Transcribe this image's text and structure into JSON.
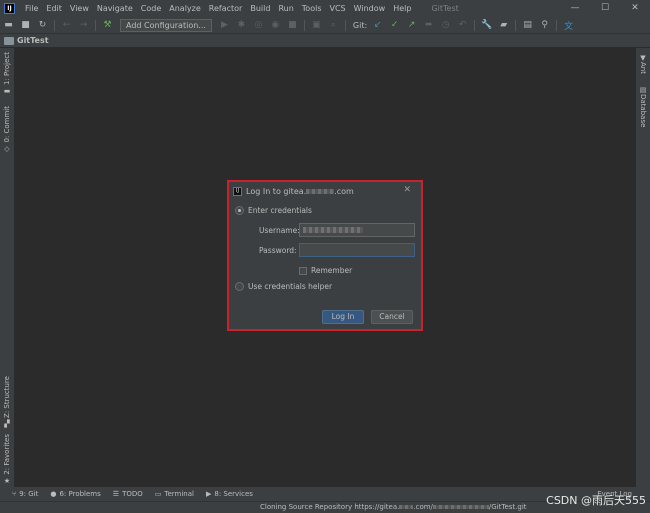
{
  "window": {
    "title": "GitTest",
    "menu": [
      "File",
      "Edit",
      "View",
      "Navigate",
      "Code",
      "Analyze",
      "Refactor",
      "Build",
      "Run",
      "Tools",
      "VCS",
      "Window",
      "Help"
    ],
    "controls": {
      "minimize": "—",
      "maximize": "☐",
      "close": "✕"
    }
  },
  "toolbar": {
    "config_label": "Add Configuration...",
    "git_label": "Git:"
  },
  "navbar": {
    "project": "GitTest"
  },
  "left_tabs": {
    "project": "1: Project",
    "commit": "0: Commit",
    "structure": "Z: Structure",
    "favorites": "2: Favorites"
  },
  "right_tabs": {
    "ant": "Ant",
    "database": "Database"
  },
  "bottom_tabs": {
    "git": "9: Git",
    "problems": "6: Problems",
    "todo": "TODO",
    "terminal": "Terminal",
    "services": "8: Services",
    "event_log": "Event Log"
  },
  "status": {
    "text_prefix": "Cloning Source Repository https://gitea.",
    "text_mid": ".com/",
    "text_suffix": "/GitTest.git"
  },
  "watermark": "CSDN @雨后天555",
  "dialog": {
    "title_prefix": "Log In to gitea.",
    "title_suffix": ".com",
    "close": "✕",
    "option_credentials": "Enter credentials",
    "option_helper": "Use credentials helper",
    "username_label": "Username:",
    "password_label": "Password:",
    "remember_label": "Remember",
    "login_button": "Log In",
    "cancel_button": "Cancel",
    "selected_option": "Enter credentials"
  }
}
